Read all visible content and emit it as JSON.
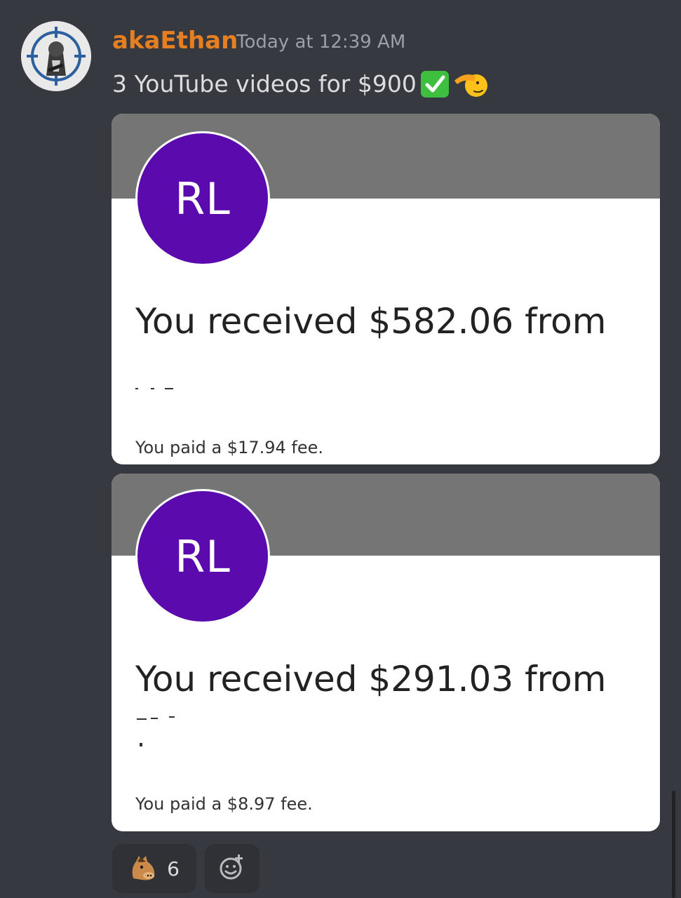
{
  "author": {
    "username": "akaEthan",
    "timestamp": "Today at 12:39 AM",
    "username_color": "#e67e22"
  },
  "message": {
    "text": "3 YouTube videos for $900",
    "emojis": [
      "check-mark-button-emoji",
      "saluting-face-emoji"
    ]
  },
  "attachments": [
    {
      "initials": "RL",
      "received_text": "You received $582.06 from",
      "fee_text": "You paid a $17.94 fee."
    },
    {
      "initials": "RL",
      "received_text": "You received $291.03 from",
      "fee_text": "You paid a $8.97 fee."
    }
  ],
  "reactions": [
    {
      "emoji": "horse-face-emoji",
      "count": "6"
    }
  ],
  "colors": {
    "background": "#36393f",
    "card_banner": "#757575",
    "avatar_circle": "#5b0bad"
  }
}
